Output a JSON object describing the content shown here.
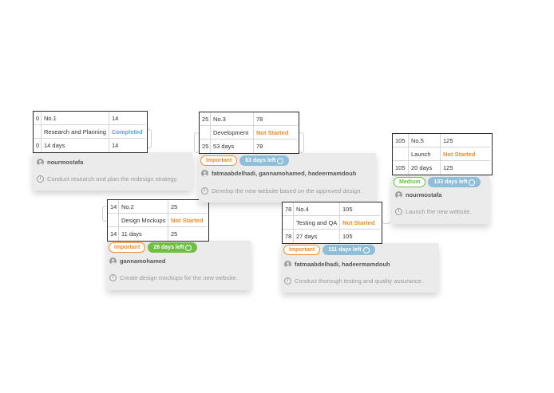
{
  "tasks": [
    {
      "id_left": "0",
      "number": "No.1",
      "parent_value": "14",
      "name": "Research and Planning",
      "status": "Completed",
      "start_offset": "0",
      "duration": "14 days",
      "end_value": "14",
      "assignees": "nourmostafa",
      "description": "Conduct research and plan the redesign strategy."
    },
    {
      "id_left": "14",
      "number": "No.2",
      "parent_value": "25",
      "name": "Design Mockups",
      "status": "Not Started",
      "start_offset": "14",
      "duration": "11 days",
      "end_value": "25",
      "priority": "Important",
      "days_left": "28 days left",
      "assignees": "gannamohamed",
      "description": "Create design mockups for the new website."
    },
    {
      "id_left": "25",
      "number": "No.3",
      "parent_value": "78",
      "name": "Development",
      "status": "Not Started",
      "start_offset": "25",
      "duration": "53 days",
      "end_value": "78",
      "priority": "Important",
      "days_left": "63 days left",
      "assignees": "fatmaabdelhadi, gannamohamed, hadeermamdouh",
      "description": "Develop the new website based on the approved design."
    },
    {
      "id_left": "78",
      "number": "No.4",
      "parent_value": "105",
      "name": "Testing and QA",
      "status": "Not Started",
      "start_offset": "78",
      "duration": "27 days",
      "end_value": "105",
      "priority": "Important",
      "days_left": "111 days left",
      "assignees": "fatmaabdelhadi, hadeermamdouh",
      "description": "Conduct thorough testing and quality assurance."
    },
    {
      "id_left": "105",
      "number": "No.5",
      "parent_value": "125",
      "name": "Launch",
      "status": "Not Started",
      "start_offset": "105",
      "duration": "20 days",
      "end_value": "125",
      "priority": "Medium",
      "days_left": "133 days left",
      "assignees": "nourmostafa",
      "description": "Launch the new website."
    }
  ],
  "colors": {
    "completed": "#4fa8d8",
    "not_started": "#f28c28",
    "important": "#f28c28",
    "medium": "#6fbf40",
    "days_left_green": "#6fbf40",
    "days_left_blue": "#8fbfd8"
  }
}
